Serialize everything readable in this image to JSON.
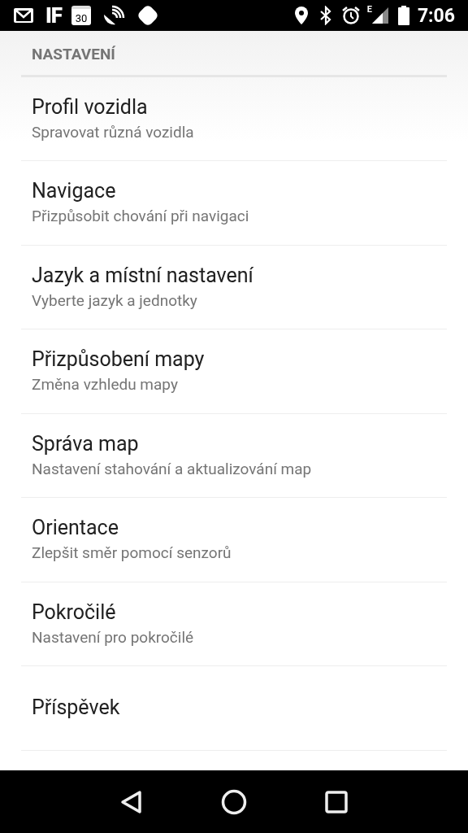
{
  "status_bar": {
    "app_label": "IF",
    "calendar_day": "30",
    "network_type": "E",
    "time": "7:06"
  },
  "section_title": "NASTAVENÍ",
  "items": [
    {
      "title": "Profil vozidla",
      "subtitle": "Spravovat různá vozidla"
    },
    {
      "title": "Navigace",
      "subtitle": "Přizpůsobit chování při navigaci"
    },
    {
      "title": "Jazyk a místní nastavení",
      "subtitle": "Vyberte jazyk a jednotky"
    },
    {
      "title": "Přizpůsobení mapy",
      "subtitle": "Změna vzhledu mapy"
    },
    {
      "title": "Správa map",
      "subtitle": "Nastavení stahování a aktualizování map"
    },
    {
      "title": "Orientace",
      "subtitle": "Zlepšit směr pomocí senzorů"
    },
    {
      "title": "Pokročilé",
      "subtitle": "Nastavení pro pokročilé"
    },
    {
      "title": "Příspěvek"
    }
  ]
}
